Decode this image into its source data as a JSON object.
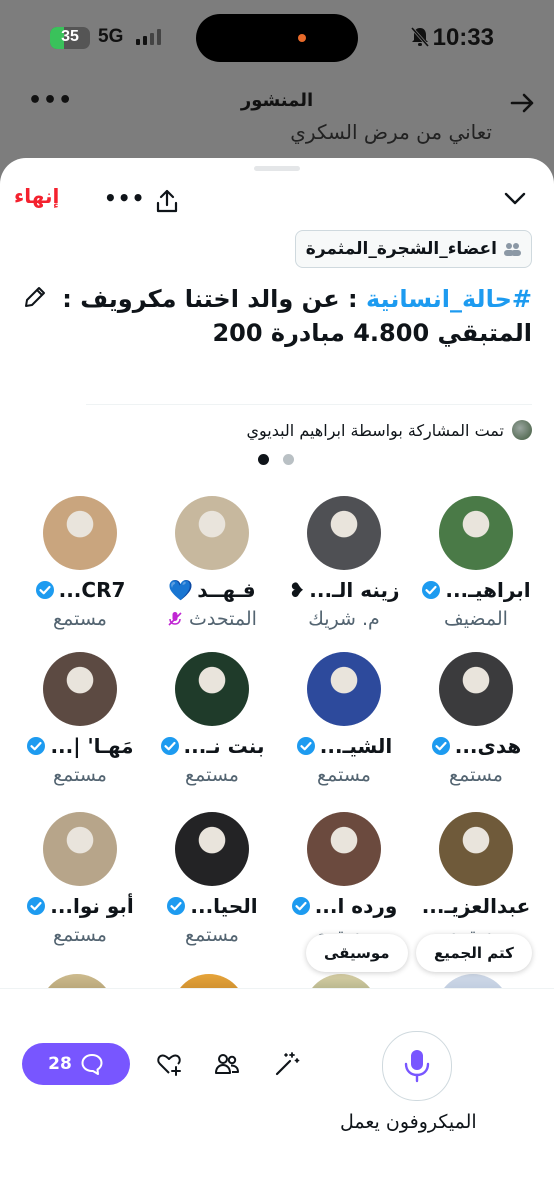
{
  "status_bar": {
    "time": "10:33",
    "battery": "35",
    "battery_level": 0.35,
    "network": "5G"
  },
  "nav": {
    "title": "المنشور",
    "behind_text": "تعاني من مرض السكري"
  },
  "space": {
    "end_label": "إنهاء",
    "community": "اعضاء_الشجرة_المثمرة",
    "title_hashtag": "#حالة_انسانية",
    "title_rest": " : عن والد اختنا مكرويف   : المتبقي 4.800 مبادرة 200",
    "shared_by": "تمت المشاركة بواسطة ابراهيم البديوي",
    "pager": {
      "pages": 2,
      "current": 1
    }
  },
  "participants": [
    {
      "name": "ابراهيـ...",
      "role": "المضيف",
      "verified": true,
      "avatar_color": "#4a7a47"
    },
    {
      "name": "زينه الـ...",
      "name_suffix": "❥",
      "role": "م. شريك",
      "verified": false,
      "avatar_color": "#4f5054"
    },
    {
      "name": "فـهــد",
      "name_suffix": "💙",
      "role": "المتحدث",
      "verified": false,
      "muted": true,
      "avatar_color": "#c7b89e"
    },
    {
      "name": "CR7...",
      "role": "مستمع",
      "verified": true,
      "avatar_color": "#c9a57e"
    },
    {
      "name": "هدى...",
      "role": "مستمع",
      "verified": true,
      "avatar_color": "#3b3b3d"
    },
    {
      "name": "الشيـ...",
      "role": "مستمع",
      "verified": true,
      "avatar_color": "#2d4a9c"
    },
    {
      "name": "بنت نـ...",
      "role": "مستمع",
      "verified": true,
      "avatar_color": "#1f3b2a"
    },
    {
      "name": "مَهـا' |...",
      "role": "مستمع",
      "verified": true,
      "avatar_color": "#5c4a42"
    },
    {
      "name": "عبدالعزيـ...",
      "role": "مستمع",
      "verified": false,
      "avatar_color": "#6f5a3a"
    },
    {
      "name": "ورده ا...",
      "role": "مستمع",
      "verified": true,
      "avatar_color": "#6b4a3e"
    },
    {
      "name": "الحيا...",
      "role": "مستمع",
      "verified": true,
      "avatar_color": "#232325"
    },
    {
      "name": "أبو نوا...",
      "role": "مستمع",
      "verified": true,
      "avatar_color": "#b7a58a"
    }
  ],
  "chips": {
    "mute_all": "كتم الجميع",
    "music": "موسيقى"
  },
  "bottom": {
    "comments_count": "28",
    "mic_label": "الميكروفون يعمل"
  },
  "colors": {
    "accent": "#1d9bf0",
    "purple": "#7856ff",
    "danger": "#f4212e",
    "dim": "#7d7d7d"
  },
  "icons": {
    "end": "end-space",
    "more": "more-horizontal-icon",
    "share": "share-icon",
    "collapse": "chevron-down-icon",
    "edit": "pencil-icon",
    "community": "people-icon",
    "verified": "verified-badge-icon",
    "comments": "comment-bubble-icon",
    "react": "heart-add-icon",
    "people": "people-icon",
    "effects": "magic-wand-icon",
    "mic": "microphone-icon"
  }
}
